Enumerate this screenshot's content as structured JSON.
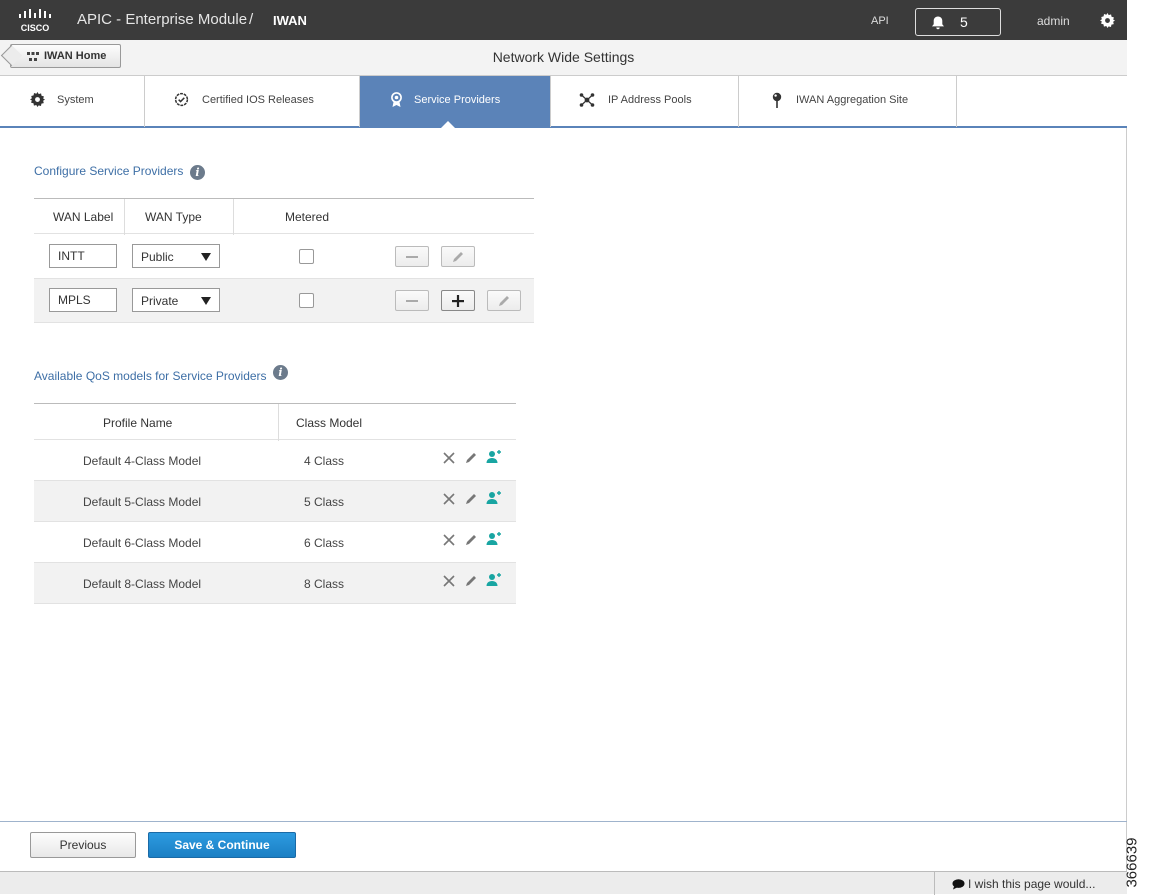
{
  "topbar": {
    "app_title": "APIC - Enterprise Module",
    "separator": "/",
    "crumb": "IWAN",
    "logo_text": "CISCO",
    "api_label": "API",
    "notification_count": "5",
    "user": "admin"
  },
  "header": {
    "home_button": "IWAN Home",
    "page_heading": "Network Wide Settings"
  },
  "tabs": [
    {
      "label": "System",
      "icon": "gear-icon"
    },
    {
      "label": "Certified IOS Releases",
      "icon": "certified-check-icon"
    },
    {
      "label": "Service Providers",
      "icon": "service-provider-icon",
      "active": true
    },
    {
      "label": "IP Address Pools",
      "icon": "ip-pool-network-icon"
    },
    {
      "label": "IWAN Aggregation Site",
      "icon": "location-pin-icon"
    }
  ],
  "service_providers": {
    "title": "Configure Service Providers",
    "columns": [
      "WAN Label",
      "WAN Type",
      "Metered"
    ],
    "rows": [
      {
        "wan_label": "INTT",
        "wan_type": "Public",
        "metered": false
      },
      {
        "wan_label": "MPLS",
        "wan_type": "Private",
        "metered": false
      }
    ]
  },
  "qos": {
    "title": "Available QoS models for Service Providers",
    "columns": [
      "Profile Name",
      "Class Model"
    ],
    "rows": [
      {
        "profile": "Default 4-Class Model",
        "class_model": "4 Class"
      },
      {
        "profile": "Default 5-Class Model",
        "class_model": "5 Class"
      },
      {
        "profile": "Default 6-Class Model",
        "class_model": "6 Class"
      },
      {
        "profile": "Default 8-Class Model",
        "class_model": "8 Class"
      }
    ]
  },
  "footer": {
    "previous": "Previous",
    "save_continue": "Save & Continue",
    "feedback": "I wish this page would..."
  },
  "figure_id": "366639",
  "colors": {
    "topbar": "#3b3b3b",
    "active_tab": "#5b83b8",
    "section_title": "#3e6fa6",
    "primary_button": "#1b7fc4",
    "add_user_icon": "#18a5a2"
  }
}
